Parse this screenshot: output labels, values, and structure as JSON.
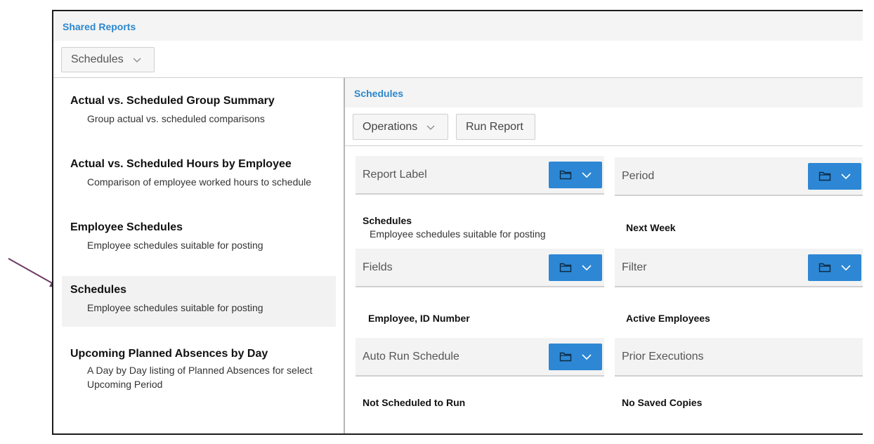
{
  "header": {
    "title": "Shared Reports"
  },
  "category_dropdown": {
    "label": "Schedules"
  },
  "report_list": [
    {
      "title": "Actual vs. Scheduled Group Summary",
      "desc": [
        "Group actual vs. scheduled comparisons"
      ]
    },
    {
      "title": "Actual vs. Scheduled Hours by Employee",
      "desc": [
        "Comparison of employee worked hours to schedule"
      ]
    },
    {
      "title": "Employee Schedules",
      "desc": [
        "Employee schedules suitable for posting"
      ]
    },
    {
      "title": "Schedules",
      "desc": [
        "Employee schedules suitable for posting"
      ],
      "selected": true
    },
    {
      "title": "Upcoming Planned Absences by Day",
      "desc": [
        "A Day by Day listing of Planned Absences for select",
        "Upcoming Period"
      ]
    }
  ],
  "detail": {
    "title": "Schedules",
    "operations_label": "Operations",
    "run_report_label": "Run Report",
    "panels": {
      "report_label": {
        "label": "Report Label",
        "value": "Schedules",
        "sub": "Employee schedules suitable for posting"
      },
      "period": {
        "label": "Period",
        "value": "Next Week"
      },
      "fields": {
        "label": "Fields",
        "value": "Employee, ID Number"
      },
      "filter": {
        "label": "Filter",
        "value": "Active Employees"
      },
      "auto_run": {
        "label": "Auto Run Schedule",
        "value": "Not Scheduled to Run"
      },
      "prior_exec": {
        "label": "Prior Executions",
        "value": "No Saved Copies"
      }
    }
  },
  "colors": {
    "accent": "#2c87cd",
    "panel_button": "#2d87d4",
    "arrow": "#6d3a63"
  }
}
